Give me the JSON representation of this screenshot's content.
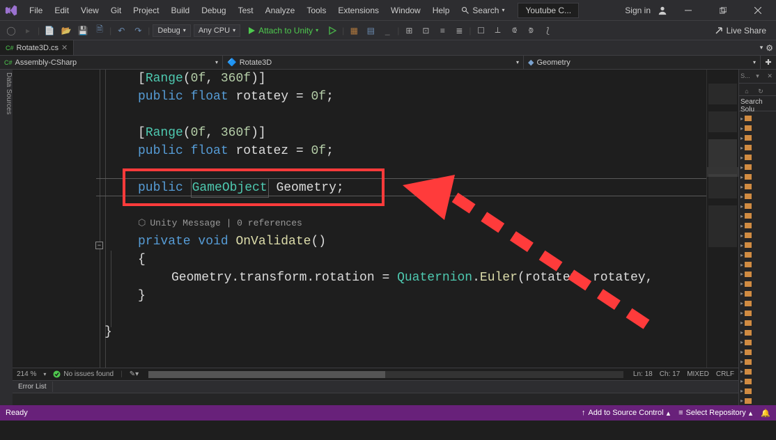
{
  "menu": [
    "File",
    "Edit",
    "View",
    "Git",
    "Project",
    "Build",
    "Debug",
    "Test",
    "Analyze",
    "Tools",
    "Extensions",
    "Window",
    "Help"
  ],
  "search_placeholder": "Search",
  "solution_btn": "Youtube C...",
  "signin": "Sign in",
  "toolbar": {
    "config": "Debug",
    "platform": "Any CPU",
    "attach": "Attach to Unity",
    "live_share": "Live Share"
  },
  "tab_file": "Rotate3D.cs",
  "left_gutter": "Data Sources",
  "nav": {
    "assembly": "Assembly-CSharp",
    "class": "Rotate3D",
    "member": "Geometry"
  },
  "code": {
    "l1a": "[",
    "l1b": "Range",
    "l1c": "(",
    "l1d": "0f",
    "l1e": ", ",
    "l1f": "360f",
    "l1g": ")]",
    "l2a": "public ",
    "l2b": "float ",
    "l2c": "rotatey = ",
    "l2d": "0f",
    "l2e": ";",
    "l3a": "[",
    "l3b": "Range",
    "l3c": "(",
    "l3d": "0f",
    "l3e": ", ",
    "l3f": "360f",
    "l3g": ")]",
    "l4a": "public ",
    "l4b": "float ",
    "l4c": "rotatez = ",
    "l4d": "0f",
    "l4e": ";",
    "l5a": "public ",
    "l5b": "GameObject",
    "l5c": " Geometry;",
    "lens": "Unity Message | 0 references",
    "l6a": "private ",
    "l6b": "void ",
    "l6c": "OnValidate",
    "l6d": "()",
    "l7": "{",
    "l8a": "Geometry.transform.rotation = ",
    "l8b": "Quaternion",
    "l8c": ".",
    "l8d": "Euler",
    "l8e": "(rotatex, rotatey,",
    "l9": "}",
    "l10": "}"
  },
  "zoom": "214 %",
  "issues": "No issues found",
  "cursor": {
    "line": "Ln: 18",
    "col": "Ch: 17"
  },
  "enc": "MIXED",
  "eol": "CRLF",
  "error_list": "Error List",
  "ready": "Ready",
  "source_control": "Add to Source Control",
  "repo": "Select Repository",
  "se_title": "S...",
  "se_search": "Search Solu"
}
